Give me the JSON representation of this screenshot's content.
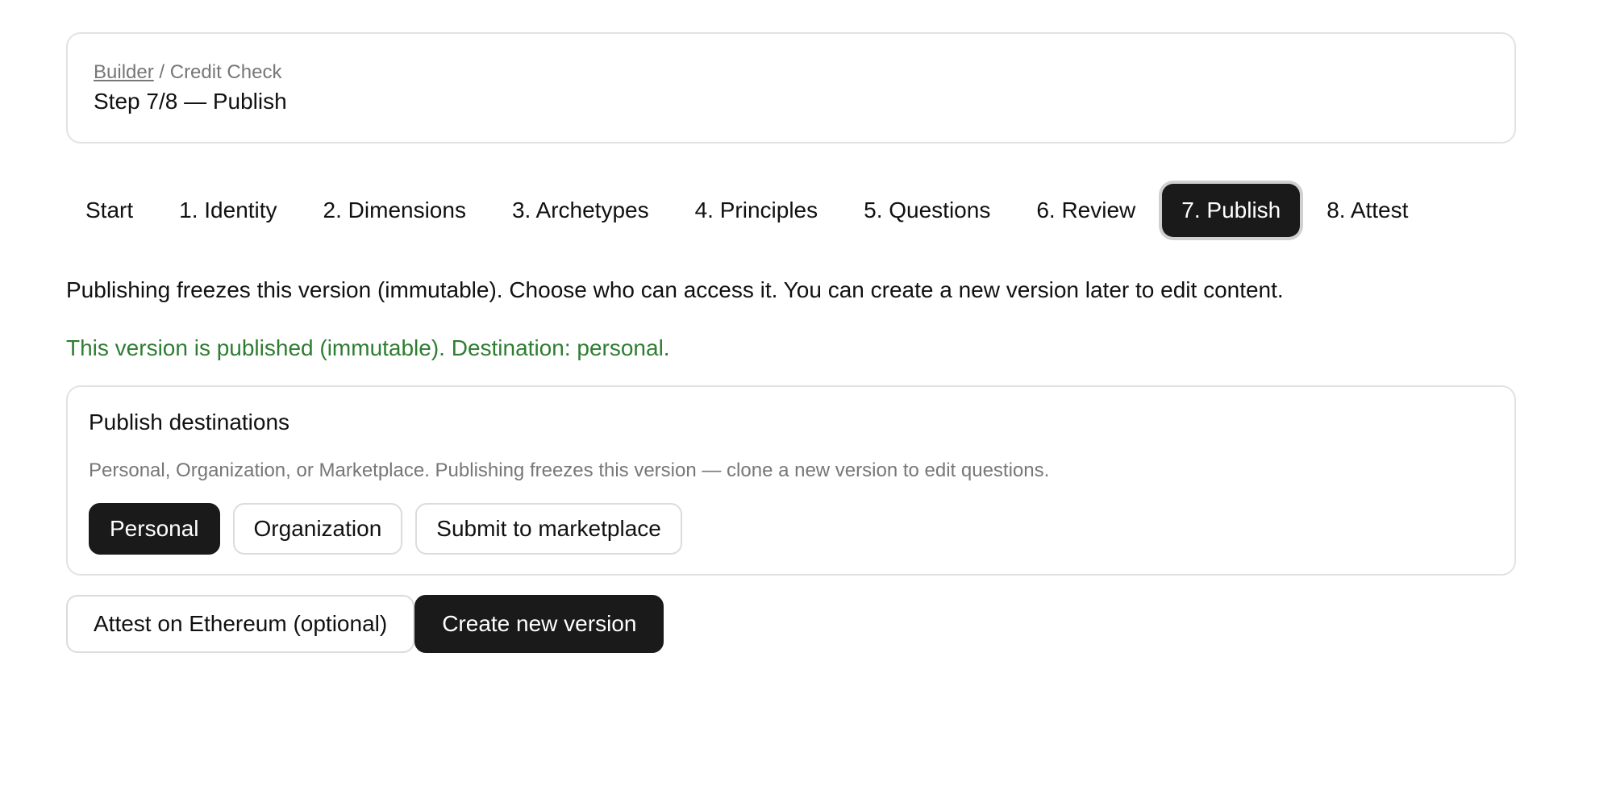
{
  "header": {
    "breadcrumb_link": "Builder",
    "breadcrumb_separator": " / ",
    "breadcrumb_current": "Credit Check",
    "title": "Step 7/8 — Publish"
  },
  "steps": [
    {
      "label": "Start",
      "active": false
    },
    {
      "label": "1. Identity",
      "active": false
    },
    {
      "label": "2. Dimensions",
      "active": false
    },
    {
      "label": "3. Archetypes",
      "active": false
    },
    {
      "label": "4. Principles",
      "active": false
    },
    {
      "label": "5. Questions",
      "active": false
    },
    {
      "label": "6. Review",
      "active": false
    },
    {
      "label": "7. Publish",
      "active": true
    },
    {
      "label": "8. Attest",
      "active": false
    }
  ],
  "intro": "Publishing freezes this version (immutable). Choose who can access it. You can create a new version later to edit content.",
  "status": "This version is published (immutable). Destination: personal.",
  "destinations": {
    "title": "Publish destinations",
    "description": "Personal, Organization, or Marketplace. Publishing freezes this version — clone a new version to edit questions.",
    "options": [
      {
        "label": "Personal",
        "selected": true
      },
      {
        "label": "Organization",
        "selected": false
      },
      {
        "label": "Submit to marketplace",
        "selected": false
      }
    ]
  },
  "actions": {
    "attest_label": "Attest on Ethereum (optional)",
    "new_version_label": "Create new version"
  },
  "colors": {
    "accent_dark": "#1a1a1a",
    "success_green": "#2e7d32",
    "muted_text": "#777777",
    "border": "#e2e2e2"
  }
}
